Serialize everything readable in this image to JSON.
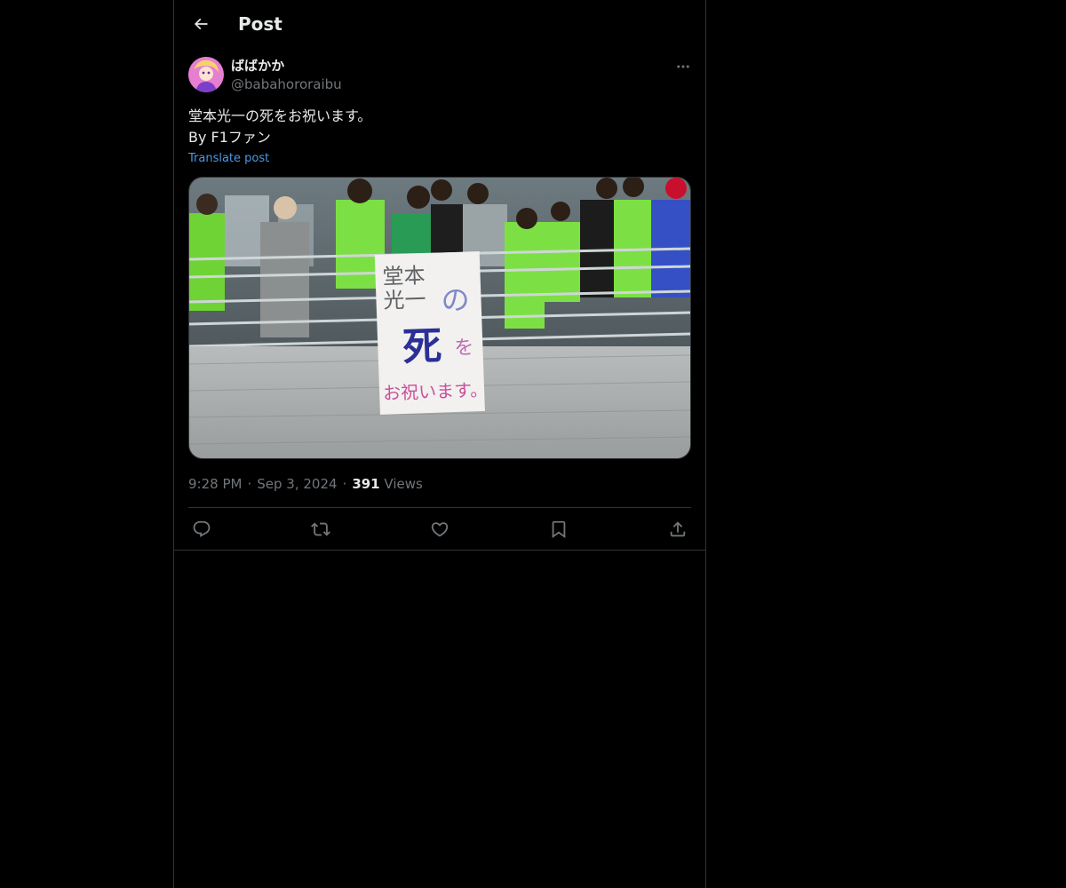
{
  "header": {
    "title": "Post",
    "back_icon": "arrow-left-icon"
  },
  "post": {
    "author": {
      "display_name": "ばばかか",
      "handle": "@babahororaibu"
    },
    "text_lines": [
      "堂本光一の死をお祝います。",
      "By F1ファン"
    ],
    "translate_label": "Translate post",
    "media": {
      "sign_lines": [
        "堂本",
        "光一",
        "の",
        "死",
        "を",
        "お祝います。"
      ]
    },
    "time": "9:28 PM",
    "date": "Sep 3, 2024",
    "views_count": "391",
    "views_label": "Views",
    "separator": "·",
    "actions": [
      {
        "name": "reply",
        "icon": "reply-icon"
      },
      {
        "name": "repost",
        "icon": "repost-icon"
      },
      {
        "name": "like",
        "icon": "heart-icon"
      },
      {
        "name": "bookmark",
        "icon": "bookmark-icon"
      },
      {
        "name": "share",
        "icon": "share-icon"
      }
    ]
  },
  "colors": {
    "background": "#000000",
    "text": "#e7e9ea",
    "muted": "#71767b",
    "link": "#4a99e9",
    "border": "#2f3336"
  }
}
